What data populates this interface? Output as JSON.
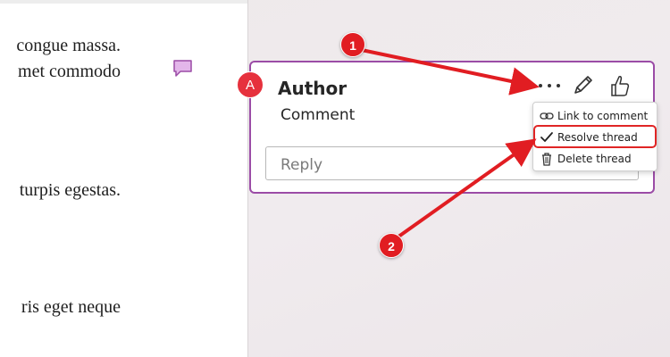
{
  "document": {
    "lines": [
      "congue massa.",
      "met commodo",
      "turpis egestas.",
      "ris eget neque"
    ]
  },
  "comment": {
    "avatar_initial": "A",
    "author": "Author",
    "text": "Comment",
    "reply_placeholder": "Reply"
  },
  "icons": {
    "more": "more-options-icon",
    "edit": "pencil-icon",
    "like": "thumbs-up-icon",
    "marker": "comment-bubble-icon"
  },
  "menu": {
    "items": [
      {
        "label": "Link to comment",
        "icon": "link-icon"
      },
      {
        "label": "Resolve thread",
        "icon": "checkmark-icon"
      },
      {
        "label": "Delete thread",
        "icon": "trash-icon"
      }
    ]
  },
  "callouts": {
    "first": "1",
    "second": "2"
  },
  "colors": {
    "accent": "#9b4ca6",
    "avatar": "#e6313d",
    "annotation_red": "#e11d22"
  }
}
